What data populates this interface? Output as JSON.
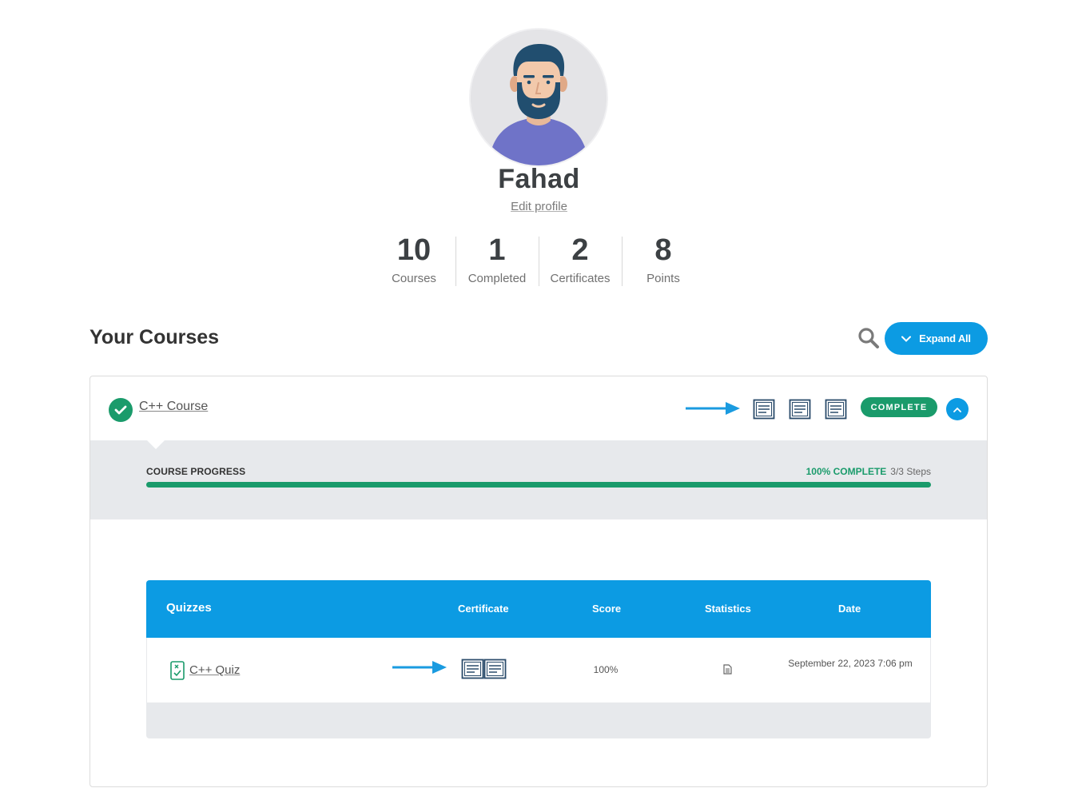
{
  "profile": {
    "name": "Fahad",
    "edit_link": "Edit profile"
  },
  "stats": [
    {
      "value": "10",
      "label": "Courses"
    },
    {
      "value": "1",
      "label": "Completed"
    },
    {
      "value": "2",
      "label": "Certificates"
    },
    {
      "value": "8",
      "label": "Points"
    }
  ],
  "courses_section": {
    "title": "Your Courses",
    "search_icon": "search-icon",
    "expand_all_label": "Expand All"
  },
  "course": {
    "title": "C++ Course",
    "status_badge": "COMPLETE",
    "certificate_icons": [
      "certificate-icon",
      "certificate-icon",
      "certificate-icon"
    ],
    "progress": {
      "label": "COURSE PROGRESS",
      "percent_text": "100% COMPLETE",
      "steps_text": "3/3 Steps",
      "value": 1.0
    }
  },
  "quizzes": {
    "headers": {
      "title": "Quizzes",
      "certificate": "Certificate",
      "score": "Score",
      "statistics": "Statistics",
      "date": "Date"
    },
    "rows": [
      {
        "title": "C++ Quiz",
        "score": "100%",
        "date": "September 22, 2023 7:06 pm"
      }
    ]
  },
  "colors": {
    "accent_blue": "#0c9be3",
    "success_green": "#1a9b6b",
    "annotation_arrow": "#1a9be0"
  }
}
